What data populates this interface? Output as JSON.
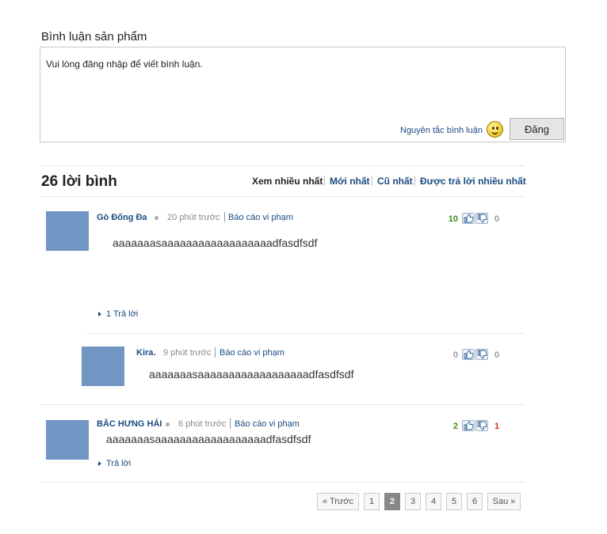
{
  "header": {
    "title": "Bình luận sản phẩm"
  },
  "composer": {
    "message": "Vui lòng đăng nhập để viết bình luận.",
    "rules_link": "Nguyên tắc bình luận",
    "post_label": "Đăng"
  },
  "summary": {
    "count_label": "26 lời bình"
  },
  "sort": {
    "most_viewed": "Xem nhiều nhất",
    "newest": "Mới nhất",
    "oldest": "Cũ nhất",
    "most_replied": "Được trả lời nhiều nhất",
    "active": "most_viewed"
  },
  "comments": [
    {
      "author": "Gò Đống Đa",
      "time": "20 phút trước",
      "report": "Báo cáo vi phạm",
      "text": "aaaaaaasaaaaaaaaaaaaaaaaaadfasdfsdf",
      "likes": "10",
      "dislikes": "0",
      "reply_label": "1 Trả lời"
    },
    {
      "author": "Kira.",
      "time": "9 phút trước",
      "report": "Báo cáo vi phạm",
      "text": "aaaaaaasaaaaaaaaaaaaaaaaaadfasdfsdf",
      "likes": "0",
      "dislikes": "0"
    },
    {
      "author": "BẮC HƯNG HẢI",
      "time": "6 phút trước",
      "report": "Báo cáo vi phạm",
      "text": "aaaaaaasaaaaaaaaaaaaaaaaaadfasdfsdf",
      "likes": "2",
      "dislikes": "1",
      "reply_label": "Trả lời"
    }
  ],
  "pagination": {
    "prev": "« Trước",
    "pages": [
      "1",
      "2",
      "3",
      "4",
      "5",
      "6"
    ],
    "current": "2",
    "next": "Sau »"
  },
  "colors": {
    "link": "#1a4c80",
    "avatar": "#7196c4",
    "like": "#3a8a17",
    "dislike": "#c8321a"
  },
  "icons": {
    "like": "thumbs-up-icon",
    "dislike": "thumbs-down-icon",
    "smiley": "smiley-icon",
    "reply": "triangle-right-icon"
  }
}
